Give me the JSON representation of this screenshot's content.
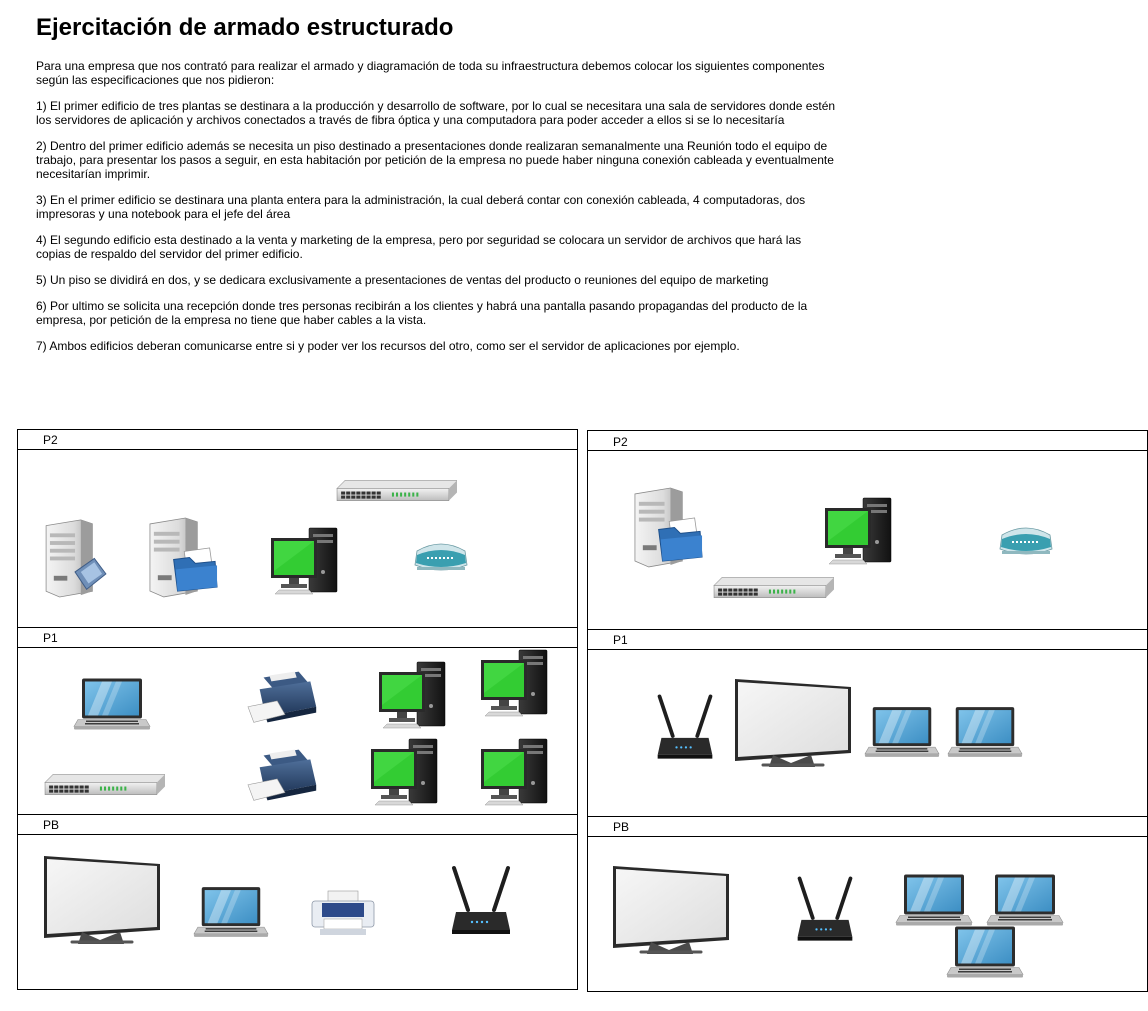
{
  "title": "Ejercitación de armado estructurado",
  "paragraphs": [
    "Para una empresa que  nos contrató para realizar el armado y diagramación de toda su infraestructura debemos colocar los siguientes componentes según las especificaciones que nos pidieron:",
    "1) El primer edificio de tres plantas se destinara a la producción y desarrollo de software, por lo cual se necesitara una sala de servidores donde estén los servidores de aplicación y archivos conectados a través de fibra óptica y una computadora para poder acceder a ellos si se lo necesitaría",
    "2) Dentro del primer edificio además se necesita un piso destinado a presentaciones donde realizaran semanalmente una Reunión todo el equipo de trabajo, para presentar los pasos a seguir, en esta habitación por petición de la empresa no puede haber ninguna conexión cableada y eventualmente necesitarían imprimir.",
    "3) En el primer edificio se destinara una planta entera para la administración, la cual deberá contar con conexión cableada, 4 computadoras, dos impresoras y una notebook para el jefe del área",
    "4) El segundo edificio esta destinado a la venta y marketing de la empresa, pero por seguridad se colocara un servidor de archivos que hará las copias de respaldo del servidor del primer edificio.",
    "5) Un piso se dividirá en dos, y se dedicara exclusivamente a presentaciones de ventas del producto o reuniones del equipo de marketing",
    "6) Por ultimo se solicita una recepción donde tres personas recibirán a los clientes y habrá una pantalla pasando propagandas del producto de la empresa, por petición de la empresa no tiene que haber cables a la vista.",
    "7) Ambos edificios deberan comunicarse entre si y poder ver los recursos del otro, como ser el servidor de aplicaciones por ejemplo."
  ],
  "buildings": {
    "left": {
      "p2": {
        "label": "P2",
        "devices": [
          "application-server-icon",
          "file-server-icon",
          "network-switch-icon",
          "desktop-computer-icon",
          "fiber-modem-icon"
        ]
      },
      "p1": {
        "label": "P1",
        "devices": [
          "laptop-icon",
          "network-switch-icon",
          "printer-icon",
          "printer-icon",
          "desktop-computer-icon",
          "desktop-computer-icon",
          "desktop-computer-icon",
          "desktop-computer-icon"
        ]
      },
      "pb": {
        "label": "PB",
        "devices": [
          "display-screen-icon",
          "laptop-icon",
          "inkjet-printer-icon",
          "wireless-router-icon"
        ]
      }
    },
    "right": {
      "p2": {
        "label": "P2",
        "devices": [
          "file-server-icon",
          "network-switch-icon",
          "desktop-computer-icon",
          "fiber-modem-icon"
        ]
      },
      "p1": {
        "label": "P1",
        "devices": [
          "wireless-router-icon",
          "display-screen-icon",
          "laptop-icon",
          "laptop-icon"
        ]
      },
      "pb": {
        "label": "PB",
        "devices": [
          "display-screen-icon",
          "wireless-router-icon",
          "laptop-icon",
          "laptop-icon",
          "laptop-icon"
        ]
      }
    }
  },
  "colors": {
    "monitor_screen": "#33cc33",
    "laptop_screen": "#5aa9d8",
    "folder_blue": "#2f6fb5",
    "modem_teal": "#3a9fb0",
    "router_black": "#1e1e1e"
  }
}
